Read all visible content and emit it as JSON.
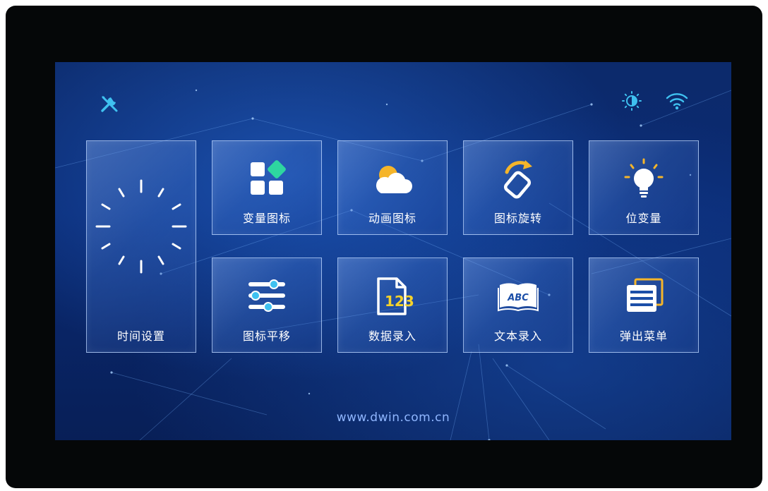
{
  "status_icons": [
    "settings-wrench-icon",
    "brightness-icon",
    "wifi-icon"
  ],
  "tiles": [
    {
      "label": "时间设置",
      "icon": "clock-icon"
    },
    {
      "label": "变量图标",
      "icon": "variable-icon"
    },
    {
      "label": "动画图标",
      "icon": "cloud-sun-icon"
    },
    {
      "label": "图标旋转",
      "icon": "rotate-icon"
    },
    {
      "label": "位变量",
      "icon": "lightbulb-icon"
    },
    {
      "label": "图标平移",
      "icon": "sliders-icon"
    },
    {
      "label": "数据录入",
      "icon": "number-input-icon"
    },
    {
      "label": "文本录入",
      "icon": "book-abc-icon"
    },
    {
      "label": "弹出菜单",
      "icon": "menu-list-icon"
    }
  ],
  "icon_text": {
    "number": "123",
    "book": "ABC"
  },
  "footer": {
    "url": "www.dwin.com.cn"
  },
  "colors": {
    "accent": "#3fc1f0",
    "tile_border": "#bed7ff",
    "url": "#8fb6ff",
    "gold": "#f5b52a",
    "green": "#2ed6a0"
  }
}
